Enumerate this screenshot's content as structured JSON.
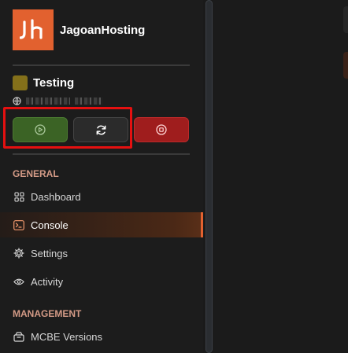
{
  "brand": {
    "name": "JagoanHosting",
    "logo_text": "Jh",
    "logo_color": "#e2612f"
  },
  "server": {
    "name": "Testing",
    "swatch_color": "#84701a",
    "address_icon": "globe-icon"
  },
  "power_buttons": [
    {
      "name": "start",
      "icon": "play-icon",
      "color": "#3b6325"
    },
    {
      "name": "restart",
      "icon": "refresh-icon",
      "color": "#2b2b2b"
    },
    {
      "name": "stop",
      "icon": "stop-icon",
      "color": "#9f1d1d"
    }
  ],
  "sections": {
    "general": "GENERAL",
    "management": "MANAGEMENT"
  },
  "nav": {
    "dashboard": "Dashboard",
    "console": "Console",
    "settings": "Settings",
    "activity": "Activity",
    "mcbe_versions": "MCBE Versions"
  },
  "accent_color": "#e2612f",
  "highlight_color": "#e51010"
}
